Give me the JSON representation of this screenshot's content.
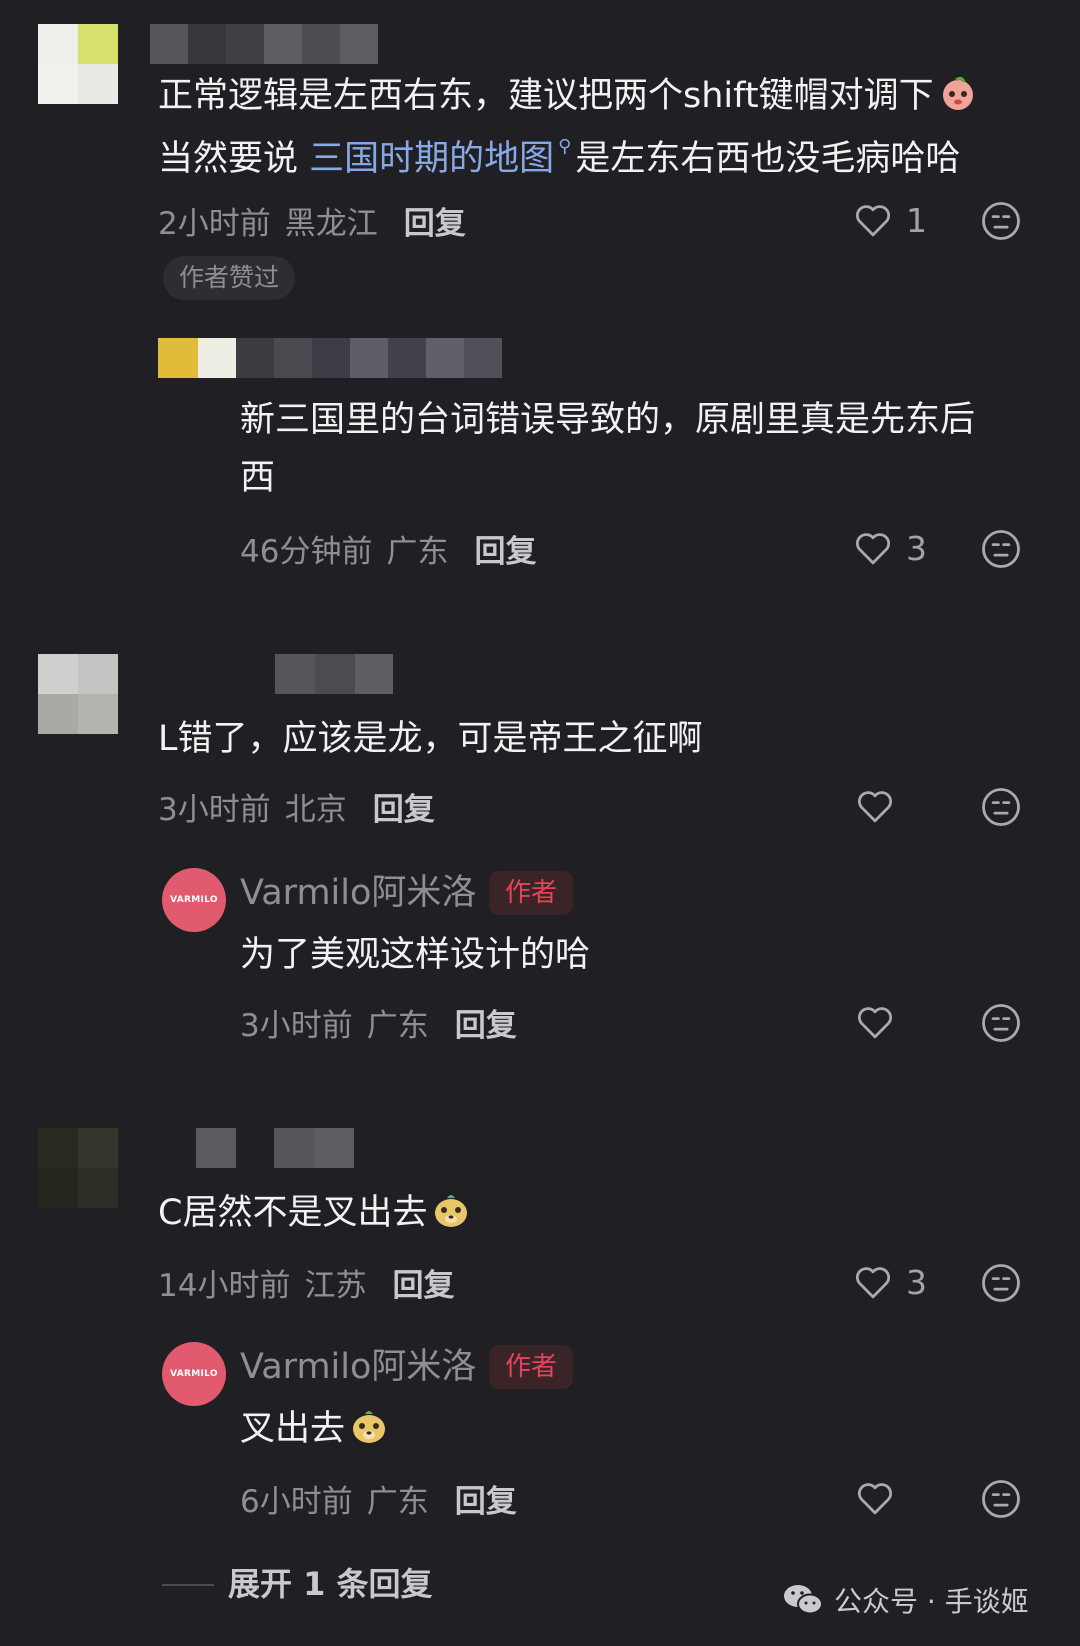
{
  "colors": {
    "background": "#1f1f24",
    "link": "#86a9e6",
    "author_accent": "#e3445a",
    "brand_avatar": "#e25a6e"
  },
  "comments": [
    {
      "line1": "正常逻辑是左西右东，建议把两个shift键帽对调下",
      "line2_prefix": "当然要说 ",
      "line2_link": "三国时期的地图",
      "line2_suffix": "是左东右西也没毛病哈哈",
      "time": "2小时前",
      "location": "黑龙江",
      "reply": "回复",
      "likes": "1",
      "author_liked": "作者赞过",
      "replies": [
        {
          "line1": "新三国里的台词错误导致的，原剧里真是先东后",
          "line2": "西",
          "time": "46分钟前",
          "location": "广东",
          "reply": "回复",
          "likes": "3"
        }
      ]
    },
    {
      "text": "L错了，应该是龙，可是帝王之征啊",
      "time": "3小时前",
      "location": "北京",
      "reply": "回复",
      "likes": "",
      "replies": [
        {
          "author": "Varmilo阿米洛",
          "author_tag": "作者",
          "avatar_text": "VARMILO",
          "text": "为了美观这样设计的哈",
          "time": "3小时前",
          "location": "广东",
          "reply": "回复",
          "likes": ""
        }
      ]
    },
    {
      "text": "C居然不是叉出去",
      "time": "14小时前",
      "location": "江苏",
      "reply": "回复",
      "likes": "3",
      "replies": [
        {
          "author": "Varmilo阿米洛",
          "author_tag": "作者",
          "avatar_text": "VARMILO",
          "text": "叉出去",
          "time": "6小时前",
          "location": "广东",
          "reply": "回复",
          "likes": ""
        }
      ]
    }
  ],
  "expand_replies": "展开 1 条回复",
  "watermark": {
    "text": "公众号 · 手谈姬",
    "icon": "wechat-icon"
  },
  "icons": {
    "like": "heart-outline-icon",
    "reaction": "emoji-face-icon",
    "emoji": "bear-emoji-icon"
  }
}
